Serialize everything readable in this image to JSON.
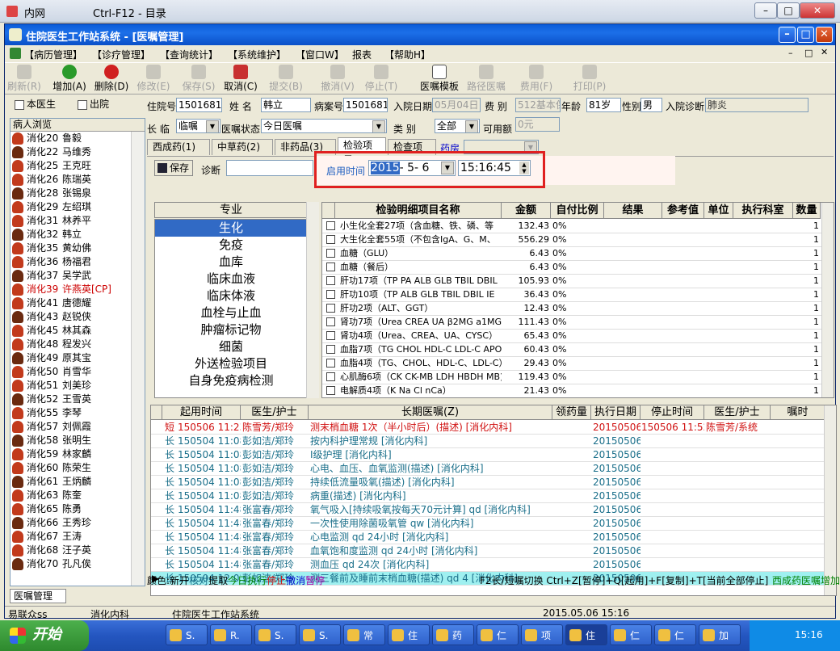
{
  "outer_window": {
    "app": "内网",
    "title": "Ctrl-F12 - 目录"
  },
  "window": {
    "title": "住院医生工作站系统 - [医嘱管理]"
  },
  "menu": [
    "【病历管理】",
    "【诊疗管理】",
    "【查询统计】",
    "【系统维护】",
    "【窗口W】",
    "报表",
    "【帮助H】"
  ],
  "toolbar": [
    {
      "label": "刷新(R)",
      "enabled": false
    },
    {
      "label": "增加(A)",
      "enabled": true
    },
    {
      "label": "删除(D)",
      "enabled": true
    },
    {
      "label": "修改(E)",
      "enabled": false
    },
    {
      "label": "保存(S)",
      "enabled": false
    },
    {
      "label": "取消(C)",
      "enabled": true
    },
    {
      "label": "提交(B)",
      "enabled": false
    },
    {
      "label": "撤消(V)",
      "enabled": false
    },
    {
      "label": "停止(T)",
      "enabled": false
    },
    {
      "label": "医嘱模板",
      "enabled": true
    },
    {
      "label": "路径医嘱",
      "enabled": false
    },
    {
      "label": "费用(F)",
      "enabled": false
    },
    {
      "label": "打印(P)",
      "enabled": false
    }
  ],
  "left": {
    "my_doctor_label": "本医生",
    "discharged_label": "出院",
    "list_header": "病人浏览",
    "patients": [
      {
        "ward": "消化20",
        "name": "鲁毅"
      },
      {
        "ward": "消化22",
        "name": "马维秀"
      },
      {
        "ward": "消化25",
        "name": "王克旺"
      },
      {
        "ward": "消化26",
        "name": "陈瑞英"
      },
      {
        "ward": "消化28",
        "name": "张锡泉"
      },
      {
        "ward": "消化29",
        "name": "左绍琪"
      },
      {
        "ward": "消化31",
        "name": "林养平"
      },
      {
        "ward": "消化32",
        "name": "韩立"
      },
      {
        "ward": "消化35",
        "name": "黄幼佛"
      },
      {
        "ward": "消化36",
        "name": "杨福君"
      },
      {
        "ward": "消化37",
        "name": "吴学武"
      },
      {
        "ward": "消化39",
        "name": "许燕英[CP]",
        "highlight": true
      },
      {
        "ward": "消化41",
        "name": "唐德耀"
      },
      {
        "ward": "消化43",
        "name": "赵锐侠"
      },
      {
        "ward": "消化45",
        "name": "林其森"
      },
      {
        "ward": "消化48",
        "name": "程发兴"
      },
      {
        "ward": "消化49",
        "name": "原其宝"
      },
      {
        "ward": "消化50",
        "name": "肖雪华"
      },
      {
        "ward": "消化51",
        "name": "刘美珍"
      },
      {
        "ward": "消化52",
        "name": "王雪英"
      },
      {
        "ward": "消化55",
        "name": "李琴"
      },
      {
        "ward": "消化57",
        "name": "刘佩霞"
      },
      {
        "ward": "消化58",
        "name": "张明生"
      },
      {
        "ward": "消化59",
        "name": "林家麟"
      },
      {
        "ward": "消化60",
        "name": "陈荣生"
      },
      {
        "ward": "消化61",
        "name": "王炳麟"
      },
      {
        "ward": "消化63",
        "name": "陈奎"
      },
      {
        "ward": "消化65",
        "name": "陈勇"
      },
      {
        "ward": "消化66",
        "name": "王秀珍"
      },
      {
        "ward": "消化67",
        "name": "王涛"
      },
      {
        "ward": "消化68",
        "name": "汪子英"
      },
      {
        "ward": "消化70",
        "name": "孔凡俟"
      }
    ]
  },
  "patient_info": {
    "inpatient_no_label": "住院号",
    "inpatient_no": "1501681",
    "name_label": "姓  名",
    "name": "韩立",
    "record_no_label": "病案号",
    "record_no": "1501681",
    "admit_date_label": "入院日期",
    "admit_date": "05月04日",
    "fee_type_label": "费  别",
    "fee_type": "512基本保险",
    "age_label": "年龄",
    "age": "81岁",
    "sex_label": "性别",
    "sex": "男",
    "diagnosis_label": "入院诊断",
    "diagnosis": "肺炎",
    "duration_label": "长  临",
    "duration": "临嘱",
    "status_label": "医嘱状态",
    "status": "今日医嘱",
    "category_label": "类  别",
    "category": "全部",
    "available_label": "可用额",
    "available": "0元"
  },
  "tabs": [
    "西成药(1)",
    "中草药(2)",
    "非药品(3)",
    "检验项目",
    "检查项目",
    "药房"
  ],
  "form": {
    "save_label": "保存",
    "diagnosis_label": "诊断",
    "start_time_label": "启用时间",
    "date_year": "2015",
    "date_rest": "- 5- 6",
    "time": "15:16:45"
  },
  "category_list": {
    "header": "专业",
    "items": [
      "生化",
      "免疫",
      "血库",
      "临床血液",
      "临床体液",
      "血栓与止血",
      "肿瘤标记物",
      "细菌",
      "外送检验项目",
      "自身免疫病检测"
    ],
    "selected": 0
  },
  "exam_grid": {
    "headers": [
      "检验明细项目名称",
      "金额",
      "自付比例",
      "结果",
      "参考值",
      "单位",
      "执行科室",
      "数量"
    ],
    "rows": [
      {
        "name": "小生化全套27项（含血糖、铁、磷、等",
        "amount": "132.43",
        "ratio": "0%",
        "qty": "1"
      },
      {
        "name": "大生化全套55项（不包含IgA、G、M、",
        "amount": "556.29",
        "ratio": "0%",
        "qty": "1"
      },
      {
        "name": "血糖（GLU）",
        "amount": "6.43",
        "ratio": "0%",
        "qty": "1"
      },
      {
        "name": "血糖（餐后）",
        "amount": "6.43",
        "ratio": "0%",
        "qty": "1"
      },
      {
        "name": "肝功17项（TP PA ALB GLB TBIL DBIL",
        "amount": "105.93",
        "ratio": "0%",
        "qty": "1"
      },
      {
        "name": "肝功10项（TP ALB GLB TBIL DBIL IE",
        "amount": "36.43",
        "ratio": "0%",
        "qty": "1"
      },
      {
        "name": "肝功2项（ALT、GGT）",
        "amount": "12.43",
        "ratio": "0%",
        "qty": "1"
      },
      {
        "name": "肾功7项（Urea CREA UA β2MG a1MG C",
        "amount": "111.43",
        "ratio": "0%",
        "qty": "1"
      },
      {
        "name": "肾功4项（Urea、CREA、UA、CYSC）",
        "amount": "65.43",
        "ratio": "0%",
        "qty": "1"
      },
      {
        "name": "血脂7项（TG CHOL HDL-C LDL-C APOA",
        "amount": "60.43",
        "ratio": "0%",
        "qty": "1"
      },
      {
        "name": "血脂4项（TG、CHOL、HDL-C、LDL-C）",
        "amount": "29.43",
        "ratio": "0%",
        "qty": "1"
      },
      {
        "name": "心肌酶6项（CK CK-MB LDH  HBDH MB)+",
        "amount": "119.43",
        "ratio": "0%",
        "qty": "1"
      },
      {
        "name": "电解质4项（K Na Cl nCa）",
        "amount": "21.43",
        "ratio": "0%",
        "qty": "1"
      }
    ]
  },
  "order_grid": {
    "headers": [
      "起用时间",
      "医生/护士",
      "长期医嘱(Z)",
      "领药量",
      "执行日期",
      "停止时间",
      "医生/护士",
      "嘱时"
    ],
    "rows": [
      {
        "type": "短",
        "start": "150506 11:23",
        "doctor": "陈雪芳/郑玲",
        "order": "测末梢血糖  1次（半小时后）(描述)  [消化内科]",
        "exec": "20150506",
        "stop": "150506 11:52",
        "stop_doctor": "陈雪芳/系统",
        "red": true
      },
      {
        "type": "长",
        "start": "150504 11:08",
        "doctor": "彭如洁/郑玲",
        "order": "按内科护理常规  [消化内科]",
        "exec": "20150506"
      },
      {
        "type": "长",
        "start": "150504 11:08",
        "doctor": "彭如洁/郑玲",
        "order": "Ⅰ级护理  [消化内科]",
        "exec": "20150506"
      },
      {
        "type": "长",
        "start": "150504 11:08",
        "doctor": "彭如洁/郑玲",
        "order": "心电、血压、血氧监测(描述)  [消化内科]",
        "exec": "20150506"
      },
      {
        "type": "长",
        "start": "150504 11:08",
        "doctor": "彭如洁/郑玲",
        "order": "持续低流量吸氧(描述)  [消化内科]",
        "exec": "20150506"
      },
      {
        "type": "长",
        "start": "150504 11:08",
        "doctor": "彭如洁/郑玲",
        "order": "病重(描述)  [消化内科]",
        "exec": "20150506"
      },
      {
        "type": "长",
        "start": "150504 11:48",
        "doctor": "张富春/郑玲",
        "order": "氧气吸入[持续吸氧按每天70元计算] qd  [消化内科]",
        "exec": "20150506"
      },
      {
        "type": "长",
        "start": "150504 11:48",
        "doctor": "张富春/郑玲",
        "order": "一次性使用除菌吸氧管 qw  [消化内科]",
        "exec": "20150506"
      },
      {
        "type": "长",
        "start": "150504 11:48",
        "doctor": "张富春/郑玲",
        "order": "心电监测 qd 24小时  [消化内科]",
        "exec": "20150506"
      },
      {
        "type": "长",
        "start": "150504 11:48",
        "doctor": "张富春/郑玲",
        "order": "血氧饱和度监测 qd 24小时  [消化内科]",
        "exec": "20150506"
      },
      {
        "type": "长",
        "start": "150504 11:48",
        "doctor": "张富春/郑玲",
        "order": "测血压 qd 24次  [消化内科]",
        "exec": "20150506"
      },
      {
        "type": "长",
        "start": "150504 12:02",
        "doctor": "彭如洁/郑玲",
        "order": "测三餐前及睡前末梢血糖(描述) qd 4  [消化内科]",
        "exec": "20150506",
        "highlight": true
      }
    ]
  },
  "legend": {
    "prefix": "颜色:",
    "items": [
      {
        "text": "新开",
        "color": "#000000"
      },
      {
        "text": "核对",
        "color": "#1a6f8a"
      },
      {
        "text": "提取",
        "color": "#000000"
      },
      {
        "text": "今日执行",
        "color": "#008000"
      },
      {
        "text": "停止",
        "color": "#d01010"
      },
      {
        "text": "撤消",
        "color": "#0000cc"
      },
      {
        "text": "暂停",
        "color": "#aa00aa"
      }
    ],
    "shortcuts": "F2长/短嘱切换 Ctrl+Z[暂停]+Q[起用]+F[复制]+T[当前全部停止]",
    "right_text": "西成药医嘱增加"
  },
  "bottom_tab": "医嘱管理",
  "status_bar": [
    "易联众ss",
    "消化内科",
    "住院医生工作站系统",
    "2015.05.06 15:16"
  ],
  "taskbar": {
    "start": "开始",
    "tasks": [
      "S.",
      "R.",
      "S.",
      "S.",
      "常",
      "住",
      "药",
      "仁",
      "项",
      "住",
      "仁",
      "仁",
      "加"
    ],
    "clock": "15:16"
  }
}
